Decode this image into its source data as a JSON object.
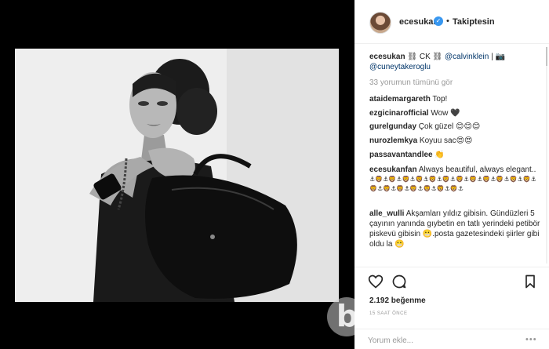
{
  "header": {
    "username": "ecesukan",
    "verified_glyph": "✓",
    "separator": "•",
    "follow_status": "Takiptesin"
  },
  "caption": {
    "username": "ecesukan",
    "text": "⛓ CK ⛓",
    "mention1": "@calvinklein",
    "separator": "|",
    "camera": "📷",
    "mention2": "@cuneytakeroglu"
  },
  "view_all": "33 yorumun tümünü gör",
  "comments": [
    {
      "user": "ataidemargareth",
      "text": "Top!"
    },
    {
      "user": "ezgicinarofficial",
      "text": "Wow 🖤"
    },
    {
      "user": "gurelgunday",
      "text": "Çok güzel 😊😊😊"
    },
    {
      "user": "nurozlemkya",
      "text": "Koyuu sac😍😍"
    },
    {
      "user": "passavantandlee",
      "text": "👏"
    },
    {
      "user": "ecesukanfan",
      "text": "Always beautiful, always elegant..",
      "emojis": "⚓🦁⚓🦁⚓🦁⚓🦁⚓🦁⚓🦁⚓🦁⚓🦁⚓🦁⚓🦁⚓🦁⚓🦁⚓🦁⚓🦁⚓🦁⚓🦁⚓🦁⚓🦁⚓🦁⚓"
    },
    {
      "user": "alle_wulli",
      "text": "Akşamları yıldız gibisin. Gündüzleri 5 çayının yanında gıybetin en tatlı yerindeki petibör piskevü gibisin 😬.posta gazetesindeki şiirler gibi oldu la 😬"
    }
  ],
  "likes": "2.192 beğenme",
  "time_ago": "15 SAAT ÖNCE",
  "comment_input": {
    "placeholder": "Yorum ekle...",
    "value": ""
  },
  "options_glyph": "•••",
  "icons": [
    "heart-icon",
    "comment-icon",
    "bookmark-icon",
    "verified-icon",
    "avatar",
    "more-options-icon"
  ],
  "colors": {
    "accent": "#3897f0",
    "mention": "#003569",
    "text": "#262626",
    "muted": "#999999"
  }
}
